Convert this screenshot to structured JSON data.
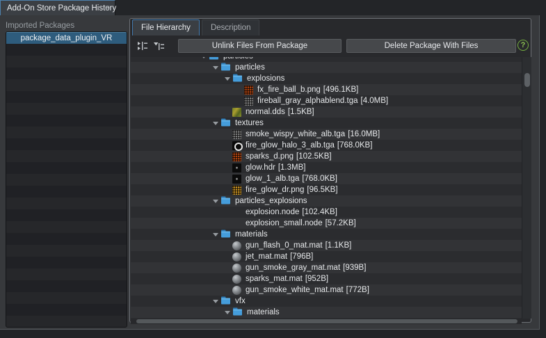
{
  "window": {
    "tab": {
      "title": "Add-On Store Package History",
      "close_glyph": "×"
    }
  },
  "sidebar": {
    "label": "Imported Packages",
    "items": [
      {
        "name": "package_data_plugin_VR",
        "selected": true
      }
    ]
  },
  "panel": {
    "tabs": [
      {
        "label": "File Hierarchy",
        "active": true
      },
      {
        "label": "Description",
        "active": false
      }
    ],
    "toolbar": {
      "unlink_label": "Unlink Files From Package",
      "delete_label": "Delete Package With Files",
      "help_glyph": "?"
    },
    "tree": {
      "rows": [
        {
          "label": "particles",
          "size": "",
          "depth": 1,
          "type": "folder",
          "expanded": true,
          "partial": true
        },
        {
          "label": "particles",
          "size": "",
          "depth": 2,
          "type": "folder",
          "expanded": true
        },
        {
          "label": "explosions",
          "size": "",
          "depth": 3,
          "type": "folder",
          "expanded": true
        },
        {
          "label": "fx_fire_ball_b.png",
          "size": "[496.1KB]",
          "depth": 4,
          "type": "tex-orange-dots"
        },
        {
          "label": "fireball_gray_alphablend.tga",
          "size": "[4.0MB]",
          "depth": 4,
          "type": "tex-gray-dots"
        },
        {
          "label": "normal.dds",
          "size": "[1.5KB]",
          "depth": 3,
          "type": "tex-normalmap"
        },
        {
          "label": "textures",
          "size": "",
          "depth": 2,
          "type": "folder",
          "expanded": true
        },
        {
          "label": "smoke_wispy_white_alb.tga",
          "size": "[16.0MB]",
          "depth": 3,
          "type": "tex-gray-dots"
        },
        {
          "label": "fire_glow_halo_3_alb.tga",
          "size": "[768.0KB]",
          "depth": 3,
          "type": "tex-ring"
        },
        {
          "label": "sparks_d.png",
          "size": "[102.5KB]",
          "depth": 3,
          "type": "tex-orange-dots"
        },
        {
          "label": "glow.hdr",
          "size": "[1.3MB]",
          "depth": 3,
          "type": "tex-dark-dot"
        },
        {
          "label": "glow_1_alb.tga",
          "size": "[768.0KB]",
          "depth": 3,
          "type": "tex-dark-dot"
        },
        {
          "label": "fire_glow_dr.png",
          "size": "[96.5KB]",
          "depth": 3,
          "type": "tex-yellow-dots"
        },
        {
          "label": "particles_explosions",
          "size": "",
          "depth": 2,
          "type": "folder",
          "expanded": true
        },
        {
          "label": "explosion.node",
          "size": "[102.4KB]",
          "depth": 3,
          "type": "node"
        },
        {
          "label": "explosion_small.node",
          "size": "[57.2KB]",
          "depth": 3,
          "type": "node"
        },
        {
          "label": "materials",
          "size": "",
          "depth": 2,
          "type": "folder",
          "expanded": true
        },
        {
          "label": "gun_flash_0_mat.mat",
          "size": "[1.1KB]",
          "depth": 3,
          "type": "material"
        },
        {
          "label": "jet_mat.mat",
          "size": "[796B]",
          "depth": 3,
          "type": "material"
        },
        {
          "label": "gun_smoke_gray_mat.mat",
          "size": "[939B]",
          "depth": 3,
          "type": "material"
        },
        {
          "label": "sparks_mat.mat",
          "size": "[952B]",
          "depth": 3,
          "type": "material"
        },
        {
          "label": "gun_smoke_white_mat.mat",
          "size": "[772B]",
          "depth": 3,
          "type": "material"
        },
        {
          "label": "vfx",
          "size": "",
          "depth": 2,
          "type": "folder",
          "expanded": true
        },
        {
          "label": "materials",
          "size": "",
          "depth": 3,
          "type": "folder",
          "expanded": true
        }
      ]
    }
  },
  "colors": {
    "accent_blue": "#4379ad",
    "selection_blue": "#2e5c7d",
    "folder_blue": "#459ddb",
    "help_green": "#76b041",
    "window_bg": "#37393c",
    "panel_bg": "#28292c"
  }
}
